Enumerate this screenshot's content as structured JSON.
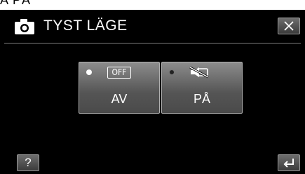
{
  "page_top_text": "A PÅ",
  "header": {
    "title": "TYST LÄGE",
    "camera_icon": "camera-icon",
    "close_icon": "close-icon"
  },
  "options": [
    {
      "icon_text": "OFF",
      "label": "AV",
      "selected": true,
      "icon": "off-icon"
    },
    {
      "icon_text": "",
      "label": "PÅ",
      "selected": false,
      "icon": "mute-icon"
    }
  ],
  "footer": {
    "help_label": "?",
    "back_icon": "back-arrow-icon"
  },
  "colors": {
    "background": "#000000",
    "button_top": "#8c8c8c",
    "button_bottom": "#4a4a4a",
    "text": "#ffffff"
  }
}
